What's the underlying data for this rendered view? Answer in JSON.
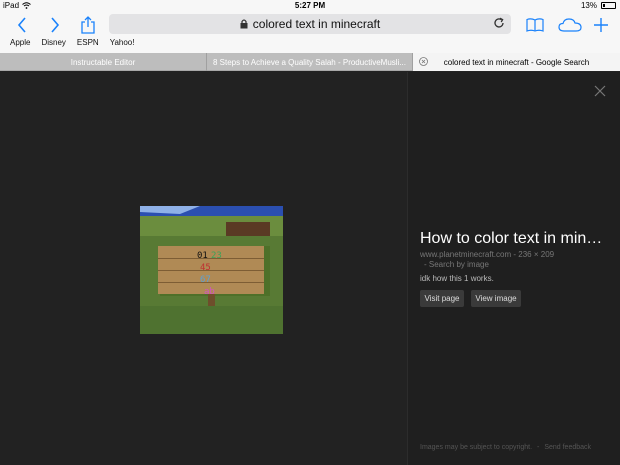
{
  "status": {
    "device": "iPad",
    "time": "5:27 PM",
    "battery": "13%"
  },
  "toolbar": {
    "url_text": "colored text in minecraft",
    "bookmarks": [
      "Apple",
      "Disney",
      "ESPN",
      "Yahoo!"
    ]
  },
  "tabs": [
    {
      "label": "Instructable Editor"
    },
    {
      "label": "8 Steps to Achieve a Quality Salah - ProductiveMusli..."
    },
    {
      "label": "colored text in minecraft - Google Search"
    }
  ],
  "result": {
    "title": "How to color text in min…",
    "source": "www.planetminecraft.com",
    "dimensions": "236 × 209",
    "search_by_image": "Search by image",
    "description": "idk how this 1 works.",
    "visit_page": "Visit page",
    "view_image": "View image",
    "copyright": "Images may be subject to copyright.",
    "feedback": "Send feedback"
  },
  "colors": {
    "accent": "#1a82fb",
    "background": "#222222",
    "panel": "#1f1f1f"
  }
}
